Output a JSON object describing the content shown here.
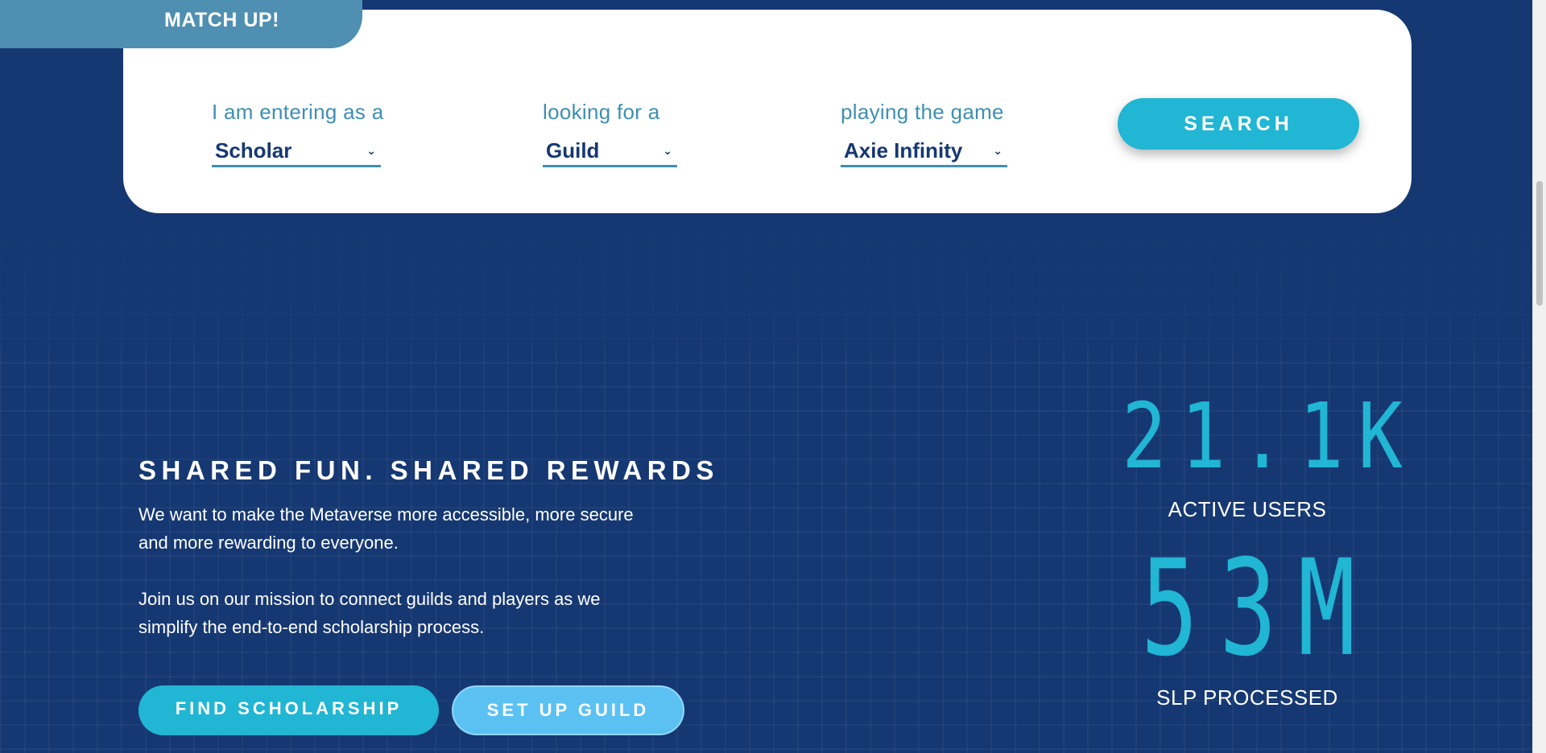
{
  "match": {
    "tab_label": "MATCH UP!",
    "role": {
      "label": "I am entering as a",
      "value": "Scholar"
    },
    "target": {
      "label": "looking for a",
      "value": "Guild"
    },
    "game": {
      "label": "playing the game",
      "value": "Axie Infinity"
    },
    "search_label": "SEARCH"
  },
  "hero": {
    "title": "SHARED FUN. SHARED REWARDS",
    "paragraph1": "We want to make the Metaverse more accessible, more secure and more rewarding to everyone.",
    "paragraph2": "Join us on our mission to connect guilds and players as we simplify the end-to-end scholarship process.",
    "find_button": "FIND SCHOLARSHIP",
    "guild_button": "SET UP GUILD"
  },
  "stats": {
    "users_value": "21.1K",
    "users_label": "ACTIVE USERS",
    "slp_value": "53M",
    "slp_label": "SLP PROCESSED"
  },
  "icons": {
    "dropdown": "chevron-down-icon"
  },
  "colors": {
    "background": "#163872",
    "accent": "#20b6d4",
    "tab": "#4f8fb2",
    "label": "#3f8fb2",
    "secondary_button": "#5bc1f2"
  }
}
